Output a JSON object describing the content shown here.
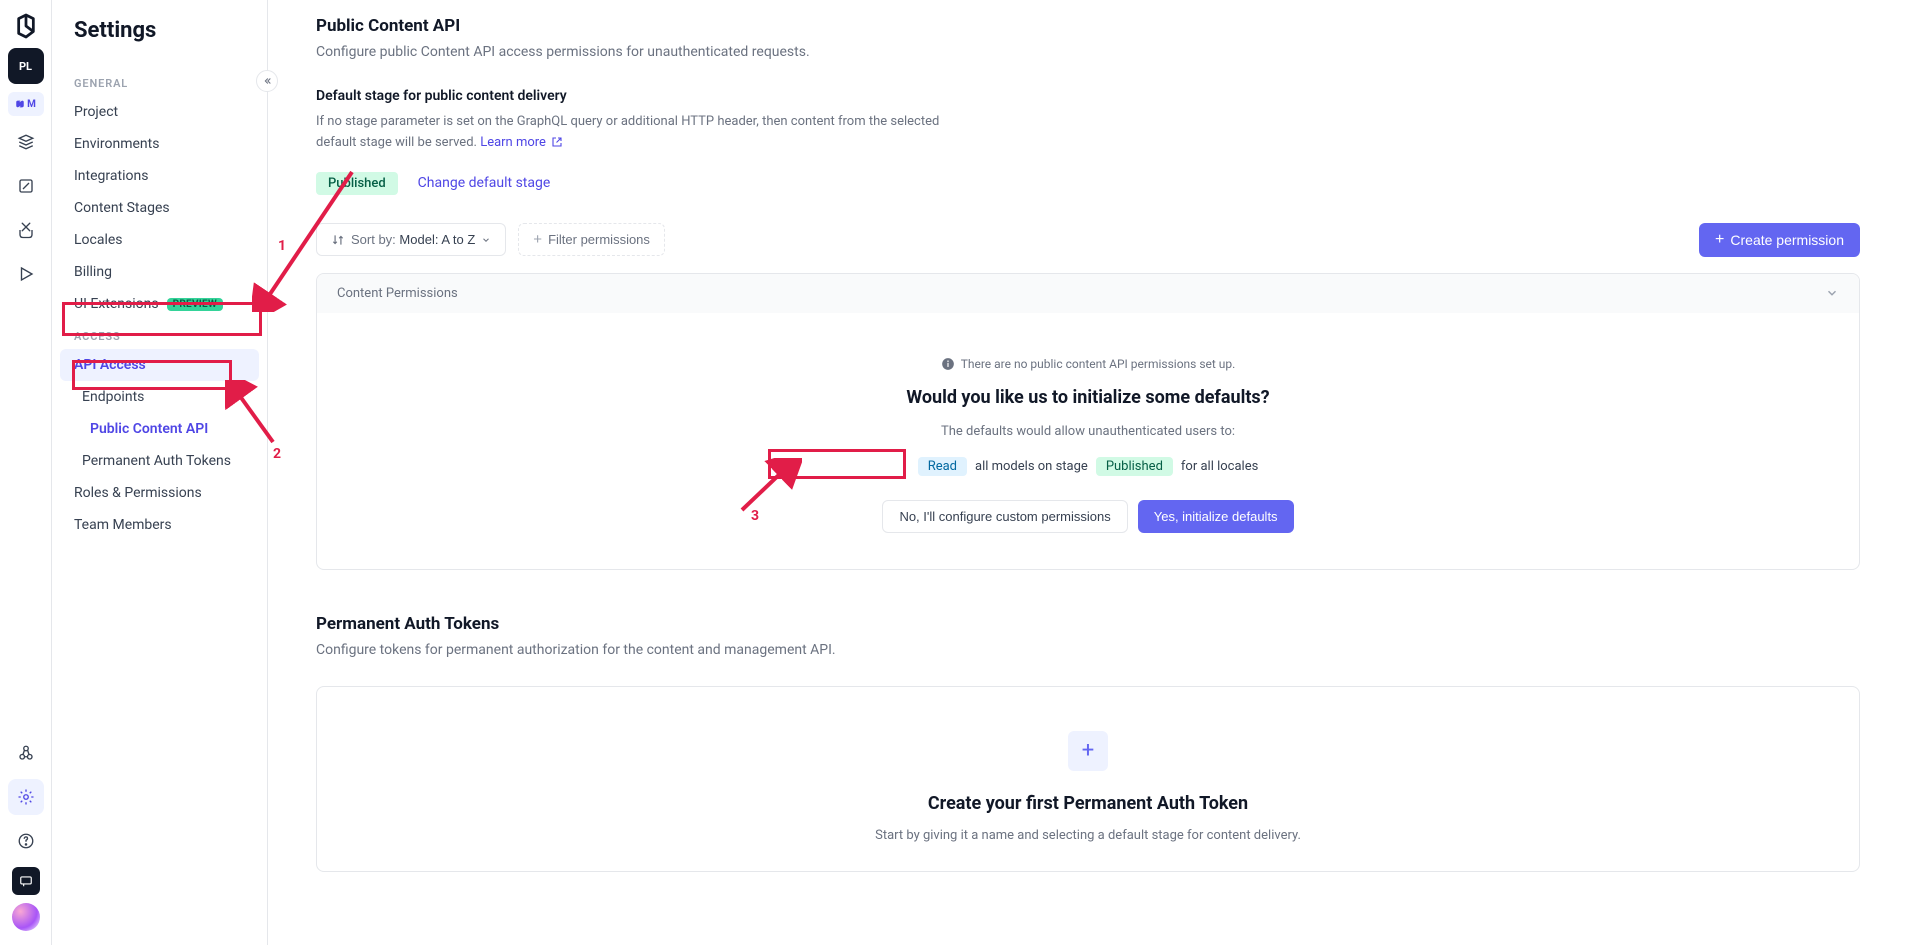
{
  "rail": {
    "project_badge": "PL",
    "env_badge": "M"
  },
  "sidebar": {
    "title": "Settings",
    "section_general": "GENERAL",
    "section_access": "ACCESS",
    "items_general": [
      "Project",
      "Environments",
      "Integrations",
      "Content Stages",
      "Locales",
      "Billing"
    ],
    "ui_extensions": "UI Extensions",
    "preview_badge": "PREVIEW",
    "api_access": "API Access",
    "endpoints": "Endpoints",
    "public_content_api": "Public Content API",
    "permanent_tokens": "Permanent Auth Tokens",
    "roles": "Roles & Permissions",
    "team": "Team Members"
  },
  "main": {
    "title": "Public Content API",
    "desc": "Configure public Content API access permissions for unauthenticated requests.",
    "stage_title": "Default stage for public content delivery",
    "stage_desc": "If no stage parameter is set on the GraphQL query or additional HTTP header, then content from the selected default stage will be served. ",
    "learn_more": "Learn more",
    "published_badge": "Published",
    "change_stage": "Change default stage",
    "sort_prefix": "Sort by: ",
    "sort_value": "Model: A to Z",
    "filter_label": "Filter permissions",
    "create_permission": "Create permission",
    "panel_header": "Content Permissions",
    "empty_info": "There are no public content API permissions set up.",
    "empty_title": "Would you like us to initialize some defaults?",
    "empty_desc": "The defaults would allow unauthenticated users to:",
    "chip_read": "Read",
    "chip_mid": "all models on stage",
    "chip_pub": "Published",
    "chip_end": "for all locales",
    "btn_no": "No, I'll configure custom permissions",
    "btn_yes": "Yes, initialize defaults",
    "tokens_title": "Permanent Auth Tokens",
    "tokens_desc": "Configure tokens for permanent authorization for the content and management API.",
    "token_create_title": "Create your first Permanent Auth Token",
    "token_create_desc": "Start by giving it a name and selecting a default stage for content delivery."
  },
  "annotations": {
    "n1": "1",
    "n2": "2",
    "n3": "3"
  }
}
